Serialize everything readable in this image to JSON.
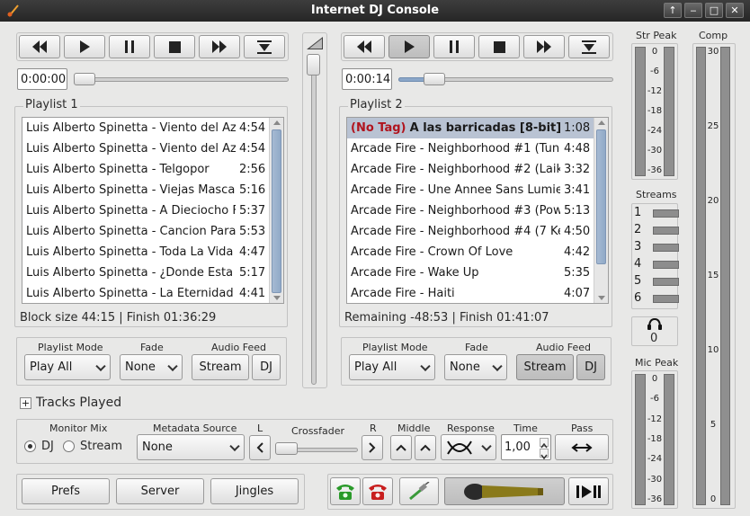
{
  "window": {
    "title": "Internet DJ Console",
    "btn_up": "↑",
    "btn_min": "‒",
    "btn_max": "□",
    "btn_close": "✕"
  },
  "left": {
    "time": "0:00:00",
    "position_fraction": 0.0,
    "playlist_title": "Playlist 1",
    "tracks": [
      {
        "name": "Luis Alberto Spinetta - Viento del Az",
        "dur": "4:54"
      },
      {
        "name": "Luis Alberto Spinetta - Viento del Az",
        "dur": "4:54"
      },
      {
        "name": "Luis Alberto Spinetta - Telgopor",
        "dur": "2:56"
      },
      {
        "name": "Luis Alberto Spinetta - Viejas Masca",
        "dur": "5:16"
      },
      {
        "name": "Luis Alberto Spinetta - A Dieciocho F",
        "dur": "5:37"
      },
      {
        "name": "Luis Alberto Spinetta - Cancion Para",
        "dur": "5:53"
      },
      {
        "name": "Luis Alberto Spinetta - Toda La Vida",
        "dur": "4:47"
      },
      {
        "name": "Luis Alberto Spinetta - ¿Donde Esta",
        "dur": "5:17"
      },
      {
        "name": "Luis Alberto Spinetta - La Eternidad",
        "dur": "4:41"
      }
    ],
    "status": "Block size 44:15 | Finish 01:36:29",
    "mode_label": "Playlist Mode",
    "mode_value": "Play All",
    "fade_label": "Fade",
    "fade_value": "None",
    "feed_label": "Audio Feed",
    "feed_stream": "Stream",
    "feed_dj": "DJ"
  },
  "right": {
    "time": "0:00:14",
    "position_fraction": 0.13,
    "playlist_title": "Playlist 2",
    "selected_tag": "(No Tag)",
    "tracks": [
      {
        "name": "A las barricadas [8-bit]",
        "dur": "1:08"
      },
      {
        "name": "Arcade Fire - Neighborhood #1 (Tun",
        "dur": "4:48"
      },
      {
        "name": "Arcade Fire - Neighborhood #2 (Laik",
        "dur": "3:32"
      },
      {
        "name": "Arcade Fire - Une Annee Sans Lumie",
        "dur": "3:41"
      },
      {
        "name": "Arcade Fire - Neighborhood #3 (Pow",
        "dur": "5:13"
      },
      {
        "name": "Arcade Fire - Neighborhood #4 (7 Ke",
        "dur": "4:50"
      },
      {
        "name": "Arcade Fire - Crown Of Love",
        "dur": "4:42"
      },
      {
        "name": "Arcade Fire - Wake Up",
        "dur": "5:35"
      },
      {
        "name": "Arcade Fire - Haiti",
        "dur": "4:07"
      }
    ],
    "status": "Remaining -48:53 | Finish 01:41:07",
    "mode_label": "Playlist Mode",
    "mode_value": "Play All",
    "fade_label": "Fade",
    "fade_value": "None",
    "feed_label": "Audio Feed",
    "feed_stream": "Stream",
    "feed_dj": "DJ"
  },
  "tracks_played": {
    "expander": "+",
    "label": "Tracks Played"
  },
  "mix": {
    "monitor_label": "Monitor Mix",
    "dj": "DJ",
    "stream": "Stream",
    "selected": "DJ",
    "metadata_label": "Metadata Source",
    "metadata_value": "None",
    "l_label": "L",
    "crossfader_label": "Crossfader",
    "r_label": "R",
    "crossfader_fraction": 0.0,
    "middle_label": "Middle",
    "response_label": "Response",
    "time_label": "Time",
    "time_value": "1,00",
    "pass_label": "Pass"
  },
  "bottom": {
    "prefs": "Prefs",
    "server": "Server",
    "jingles": "Jingles"
  },
  "meters": {
    "str_peak_label": "Str Peak",
    "peak_scale": [
      "0",
      "-6",
      "-12",
      "-18",
      "-24",
      "-30",
      "-36"
    ],
    "streams_label": "Streams",
    "streams": [
      "1",
      "2",
      "3",
      "4",
      "5",
      "6"
    ],
    "listeners": "0",
    "mic_peak_label": "Mic Peak",
    "comp_label": "Comp",
    "comp_scale": [
      "30",
      "25",
      "20",
      "15",
      "10",
      "5",
      "0"
    ]
  },
  "colors": {
    "accent": "#8aa6c8",
    "selection": "#b9c3d3",
    "tag_red": "#b0141e",
    "phone_green": "#2a9a2a",
    "phone_red": "#c81e1e"
  }
}
